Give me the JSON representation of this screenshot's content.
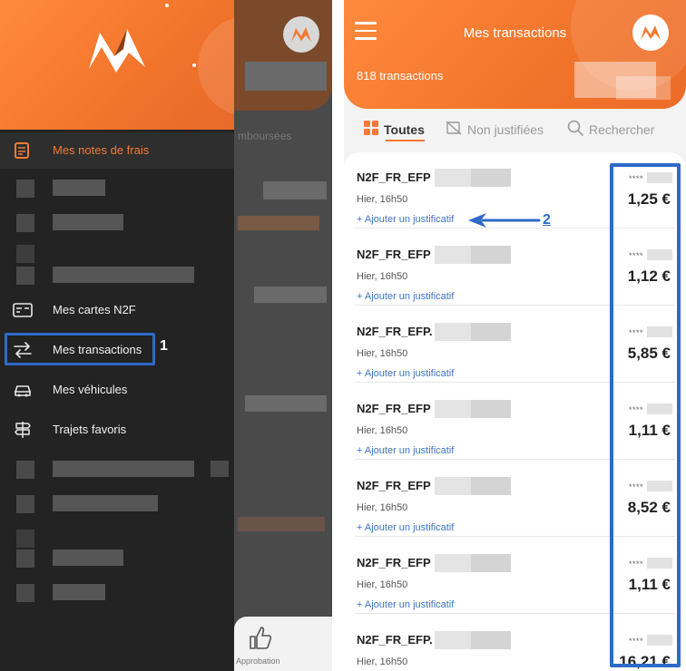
{
  "drawer": {
    "items": [
      {
        "label": "Mes notes de frais",
        "icon": "expense-report-icon",
        "active": true
      },
      {
        "label": "Mes cartes N2F",
        "icon": "card-icon"
      },
      {
        "label": "Mes transactions",
        "icon": "transfer-arrows-icon"
      },
      {
        "label": "Mes véhicules",
        "icon": "car-icon"
      },
      {
        "label": "Trajets favoris",
        "icon": "signpost-icon"
      }
    ]
  },
  "background_screen": {
    "partial_text": "mboursées",
    "bottom_label": "Approbation"
  },
  "annotations": {
    "step1": "1",
    "step2": "2"
  },
  "right": {
    "title": "Mes transactions",
    "count": "818 transactions",
    "tabs": [
      {
        "label": "Toutes",
        "icon": "grid-icon",
        "active": true
      },
      {
        "label": "Non justifiées",
        "icon": "no-receipt-icon"
      },
      {
        "label": "Rechercher",
        "icon": "search-icon"
      }
    ],
    "transactions": [
      {
        "name": "N2F_FR_EFP",
        "date": "Hier, 16h50",
        "action": "+ Ajouter un justificatif",
        "card": "****",
        "amount": "1,25 €"
      },
      {
        "name": "N2F_FR_EFP",
        "date": "Hier, 16h50",
        "action": "+ Ajouter un justificatif",
        "card": "****",
        "amount": "1,12 €"
      },
      {
        "name": "N2F_FR_EFP.",
        "date": "Hier, 16h50",
        "action": "+ Ajouter un justificatif",
        "card": "****",
        "amount": "5,85 €"
      },
      {
        "name": "N2F_FR_EFP",
        "date": "Hier, 16h50",
        "action": "+ Ajouter un justificatif",
        "card": "****",
        "amount": "1,11 €"
      },
      {
        "name": "N2F_FR_EFP",
        "date": "Hier, 16h50",
        "action": "+ Ajouter un justificatif",
        "card": "****",
        "amount": "8,52 €"
      },
      {
        "name": "N2F_FR_EFP",
        "date": "Hier, 16h50",
        "action": "+ Ajouter un justificatif",
        "card": "****",
        "amount": "1,11 €"
      },
      {
        "name": "N2F_FR_EFP.",
        "date": "Hier, 16h50",
        "action": "",
        "card": "****",
        "amount": "16,21 €"
      }
    ]
  },
  "colors": {
    "brand_orange": "#f27a35",
    "highlight_blue": "#2e6ac8",
    "link_blue": "#3b73c4"
  }
}
